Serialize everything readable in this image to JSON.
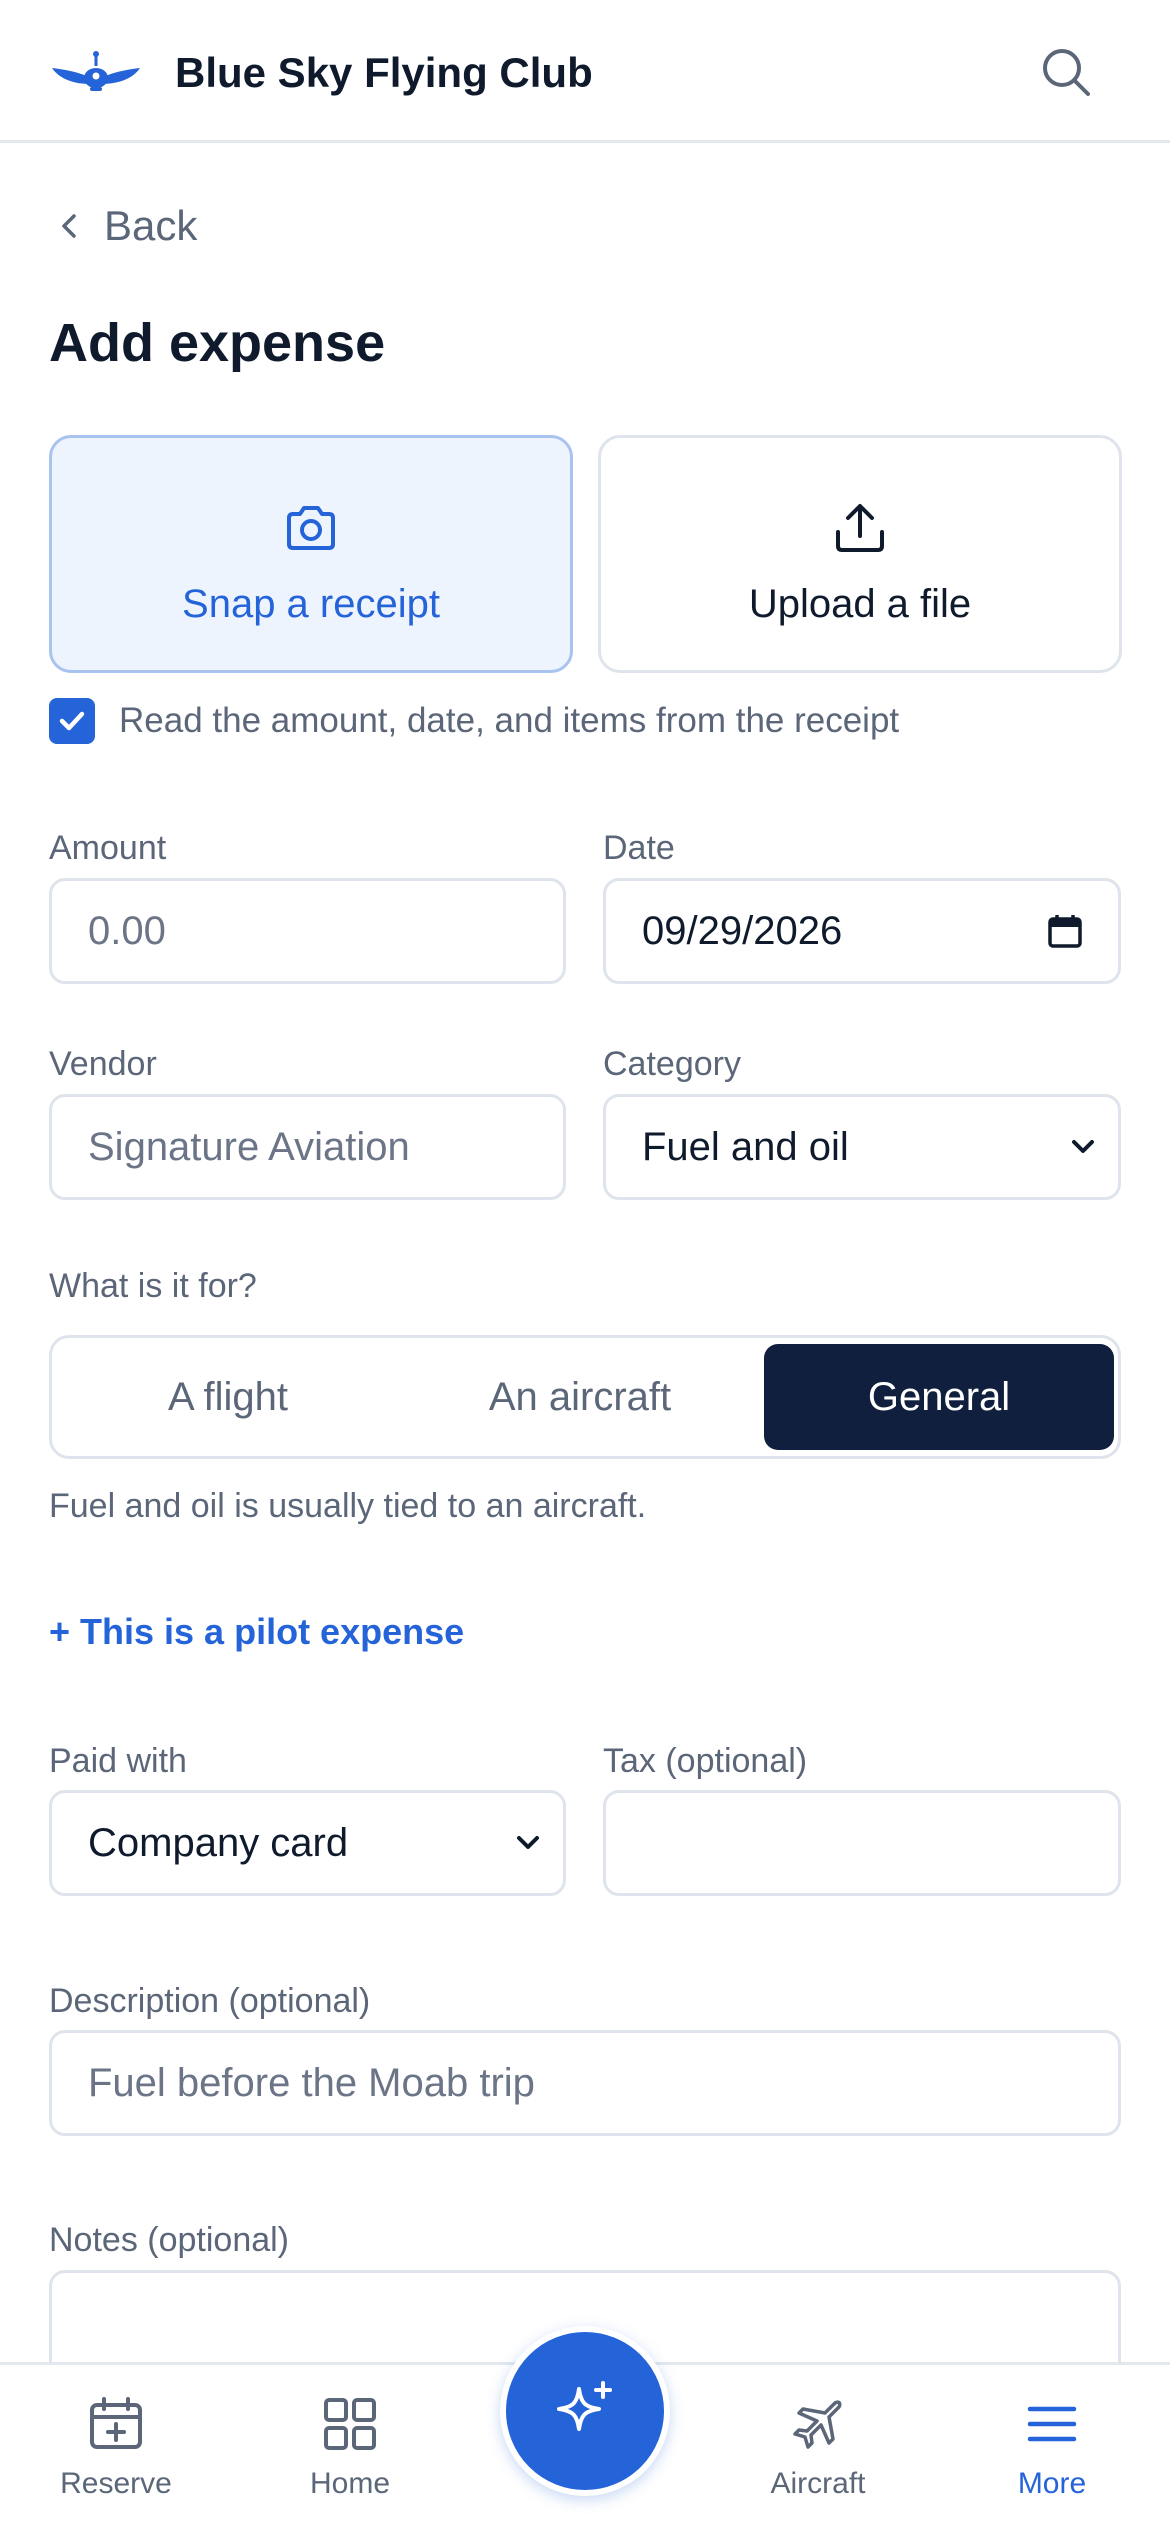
{
  "header": {
    "app_title": "Blue Sky Flying Club",
    "logo_icon": "plane-wings-logo",
    "search_icon": "search-icon"
  },
  "nav": {
    "back_label": "Back"
  },
  "page": {
    "title": "Add expense"
  },
  "capture": {
    "snap_label": "Snap a receipt",
    "upload_label": "Upload a file",
    "auto_read_label": "Read the amount, date, and items from the receipt",
    "auto_read_checked": true
  },
  "form": {
    "amount": {
      "label": "Amount",
      "placeholder": "0.00",
      "value": ""
    },
    "date": {
      "label": "Date",
      "value": "09/29/2026"
    },
    "vendor": {
      "label": "Vendor",
      "placeholder": "Signature Aviation",
      "value": ""
    },
    "category": {
      "label": "Category",
      "value": "Fuel and oil"
    },
    "purpose": {
      "label": "What is it for?",
      "options": [
        "A flight",
        "An aircraft",
        "General"
      ],
      "selected": "General",
      "hint": "Fuel and oil is usually tied to an aircraft."
    },
    "pilot_link": "+ This is a pilot expense",
    "paid_with": {
      "label": "Paid with",
      "value": "Company card"
    },
    "tax": {
      "label": "Tax (optional)",
      "value": ""
    },
    "description": {
      "label": "Description (optional)",
      "placeholder": "Fuel before the Moab trip",
      "value": ""
    },
    "notes": {
      "label": "Notes (optional)",
      "value": ""
    }
  },
  "tabbar": {
    "items": [
      {
        "label": "Reserve",
        "icon": "calendar-plus-icon",
        "active": false
      },
      {
        "label": "Home",
        "icon": "grid-icon",
        "active": false
      },
      {
        "label": "Aircraft",
        "icon": "airplane-icon",
        "active": false
      },
      {
        "label": "More",
        "icon": "menu-icon",
        "active": true
      }
    ],
    "fab_icon": "sparkle-icon"
  },
  "colors": {
    "accent": "#2563d8",
    "dark": "#0f1f3d",
    "muted_text": "#5b6678",
    "border": "#dfe4ec"
  }
}
